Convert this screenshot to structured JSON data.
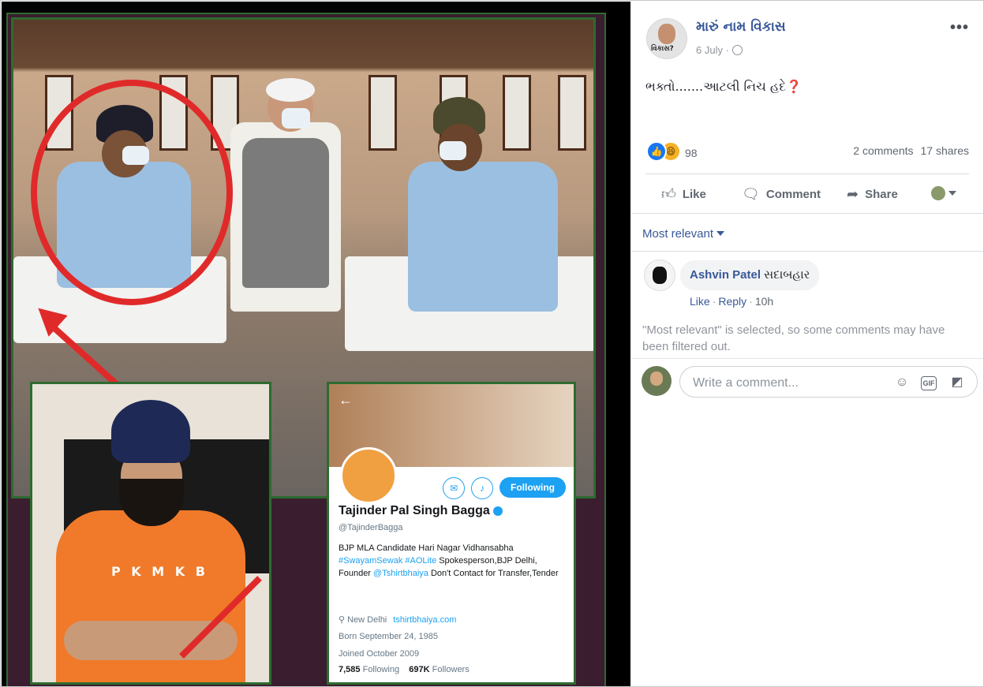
{
  "image_inset": {
    "tshirt_print": "P K M K B",
    "profile": {
      "back_glyph": "←",
      "follow_button": "Following",
      "name": "Tajinder Pal Singh Bagga",
      "handle": "@TajinderBagga",
      "bio_prefix": "BJP MLA Candidate Hari Nagar Vidhansabha",
      "bio_tags": "#SwayamSewak #AOLite",
      "bio_mid": "Spokesperson,BJP Delhi, Founder",
      "bio_mention": "@Tshirtbhaiya",
      "bio_suffix": "Don't Contact for Transfer,Tender",
      "location": "New Delhi",
      "website": "tshirtbhaiya.com",
      "born": "Born September 24, 1985",
      "joined": "Joined October 2009",
      "following_count": "7,585",
      "following_label": "Following",
      "followers_count": "697K",
      "followers_label": "Followers"
    }
  },
  "post": {
    "page_name": "મારું નામ વિકાસ",
    "avatar_caption": "વિકાસ?",
    "date": "6 July",
    "more_glyph": "•••",
    "text": "ભક્તો.......આટલી નિચ હદે❓",
    "reaction_count": "98",
    "comments_count": "2 comments",
    "shares_count": "17 shares",
    "icons": {
      "like": "thumbs-up-icon",
      "haha": "laughing-face-icon",
      "privacy": "globe-icon"
    },
    "colors": {
      "link": "#385898",
      "like_reaction": "#1877f2",
      "haha_reaction": "#f7b125",
      "annotation_red": "#e02a2a"
    }
  },
  "actions": {
    "like": "Like",
    "comment": "Comment",
    "share": "Share"
  },
  "comments": {
    "sort_label": "Most relevant",
    "items": [
      {
        "author": "Ashvin Patel",
        "text": "સદાબહાર",
        "like": "Like",
        "reply": "Reply",
        "time": "10h"
      }
    ],
    "filter_note": "\"Most relevant\" is selected, so some comments may have been filtered out.",
    "composer_placeholder": "Write a comment...",
    "gif_label": "GIF"
  }
}
